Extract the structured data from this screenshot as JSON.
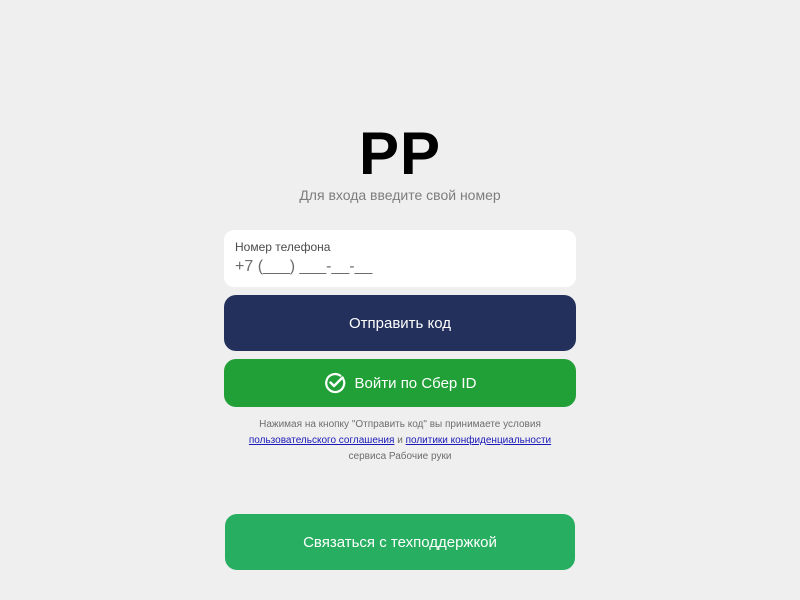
{
  "header": {
    "logo": "РР",
    "subtitle": "Для входа введите свой номер"
  },
  "phone": {
    "label": "Номер телефона",
    "placeholder": "+7 (___) ___-__-__",
    "value": ""
  },
  "buttons": {
    "send_code": "Отправить код",
    "sber_id": "Войти по Сбер ID",
    "support": "Связаться с техподдержкой"
  },
  "terms": {
    "text_before": "Нажимая на кнопку \"Отправить код\" вы принимаете условия",
    "user_agreement_link": "пользовательского соглашения",
    "conjunction": "и",
    "privacy_link": "политики конфиденциальности",
    "text_after": "сервиса Рабочие руки"
  },
  "icons": {
    "sber": "sber-check-icon"
  },
  "colors": {
    "background": "#efefef",
    "send_button": "#23305c",
    "sber_button": "#21a038",
    "support_button": "#27ae60",
    "link": "#1a1ab8"
  }
}
